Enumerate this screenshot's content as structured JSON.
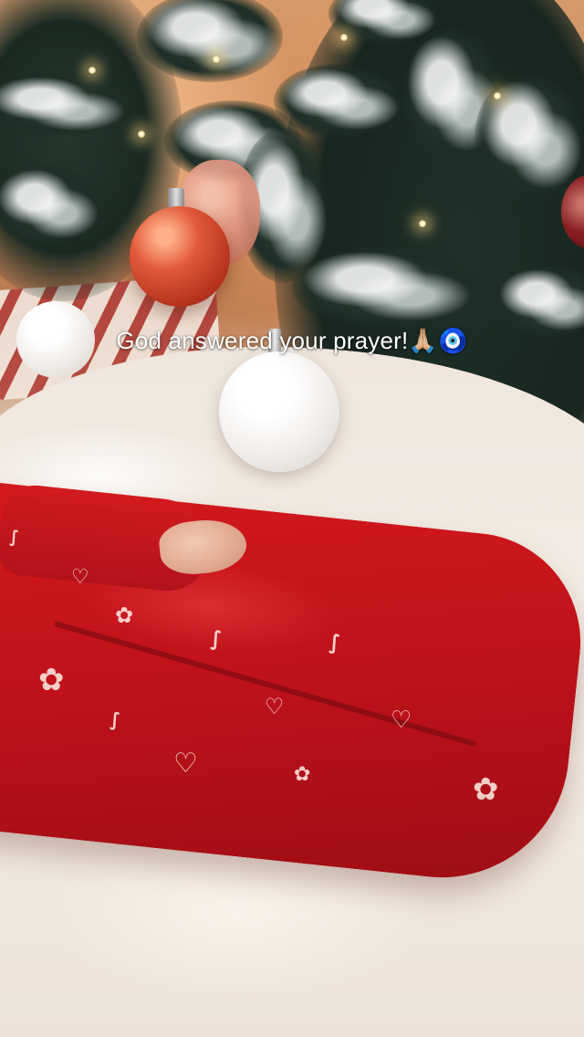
{
  "story": {
    "caption": "God answered your prayer!🙏🏼🧿"
  },
  "scene": {
    "subject": "baby in red candy-cane print sleeper lying under a snowy Christmas tree",
    "colors": {
      "sleeper_red": "#c1121a",
      "blanket_white": "#f1e8df",
      "tree_green": "#1e3128",
      "ornament_red": "#e35a3a"
    },
    "icons": [
      "praying-hands-emoji",
      "evil-eye-emoji"
    ]
  }
}
